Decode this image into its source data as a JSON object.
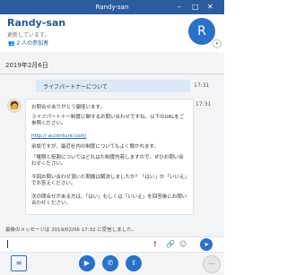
{
  "window": {
    "title": "Randy-san",
    "minimize": "–",
    "maximize": "□",
    "close": "✕"
  },
  "header": {
    "name": "Randy-san",
    "status": "更新しています。",
    "participants": "2 人の参加者",
    "avatar_initials": "R",
    "icons": [
      "person-icon",
      "chevron-down-icon"
    ]
  },
  "chat": {
    "date": "2019年2月6日",
    "messages": [
      {
        "text": "ライフパートナーについて",
        "time": "17:31"
      },
      {
        "time": "17:31",
        "lines": [
          "お問合せありがとう御座います。",
          "ライフパートナー制度に関するお問い合わせですね。以下のURLをご参照ください。",
          "http://         accenture.com/",
          "余談ですが、最近社内の制度についてもよく聞かれます。",
          "「権限と役割についてはどれはた制度内容しますので、ぜひお問い合わせください。",
          "今回お問い合わせ頂いた問題は解決しましたか？「はい」か「いいえ」でお答えください。",
          "次の問合せがある方は、「はい」もしくは「いいえ」を回答後にお問い合わせください。"
        ]
      }
    ],
    "last_message": "最後のメッセージは 2019/02/06 17:32 に受信しました。"
  },
  "input": {
    "icons": [
      "alert-icon",
      "attach-icon",
      "emoji-icon",
      "send-icon"
    ]
  },
  "footer": {
    "icons": [
      "menu-icon",
      "video-icon",
      "call-icon",
      "share-icon",
      "more-icon"
    ]
  }
}
